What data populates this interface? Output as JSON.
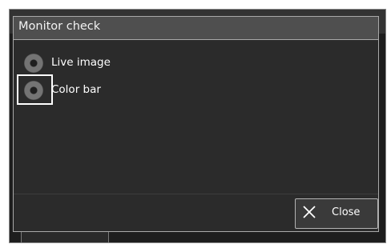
{
  "dialog": {
    "title": "Monitor check",
    "options": [
      {
        "label": "Live image",
        "selected": false
      },
      {
        "label": "Color bar",
        "selected": false
      }
    ],
    "close_label": "Close"
  }
}
